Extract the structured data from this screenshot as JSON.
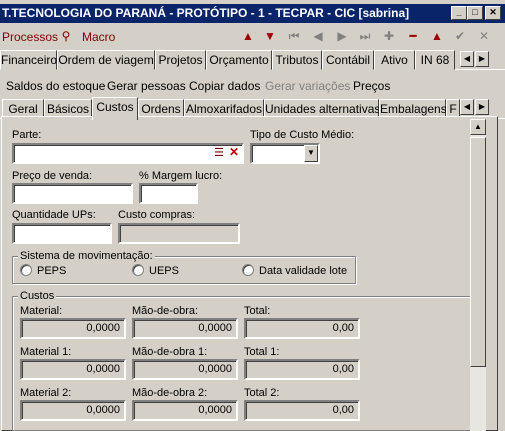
{
  "window": {
    "title": "T.TECNOLOGIA DO PARANÁ - PROTÓTIPO - 1 - TECPAR - CIC [sabrina]"
  },
  "menu": {
    "processos": "Processos",
    "macro": "Macro"
  },
  "top_tabs": [
    "Financeiro",
    "Ordem de viagem",
    "Projetos",
    "Orçamento",
    "Tributos",
    "Contábil",
    "Ativo",
    "IN 68"
  ],
  "links": [
    "Saldos do estoque",
    "Gerar pessoas",
    "Copiar dados",
    "Gerar variações",
    "Preços"
  ],
  "sub_tabs": [
    "Geral",
    "Básicos",
    "Custos",
    "Ordens",
    "Almoxarifados",
    "Unidades alternativas",
    "Embalagens",
    "F"
  ],
  "form": {
    "parte_label": "Parte:",
    "tipo_custo_label": "Tipo de Custo Médio:",
    "preco_venda_label": "Preço de venda:",
    "margem_label": "% Margem lucro:",
    "quantidade_label": "Quantidade UPs:",
    "custo_compras_label": "Custo compras:",
    "sistema_label": "Sistema de movimentação:",
    "radio_peps": "PEPS",
    "radio_ueps": "UEPS",
    "radio_data": "Data validade lote",
    "custos_label": "Custos",
    "material_label": "Material:",
    "maodeobra_label": "Mão-de-obra:",
    "total_label": "Total:",
    "material1_label": "Material 1:",
    "maodeobra1_label": "Mão-de-obra 1:",
    "total1_label": "Total 1:",
    "material2_label": "Material 2:",
    "maodeobra2_label": "Mão-de-obra 2:",
    "total2_label": "Total 2:",
    "material_val": "0,0000",
    "maodeobra_val": "0,0000",
    "total_val": "0,00",
    "material1_val": "0,0000",
    "maodeobra1_val": "0,0000",
    "total1_val": "0,00",
    "material2_val": "0,0000",
    "maodeobra2_val": "0,0000",
    "total2_val": "0,00"
  }
}
